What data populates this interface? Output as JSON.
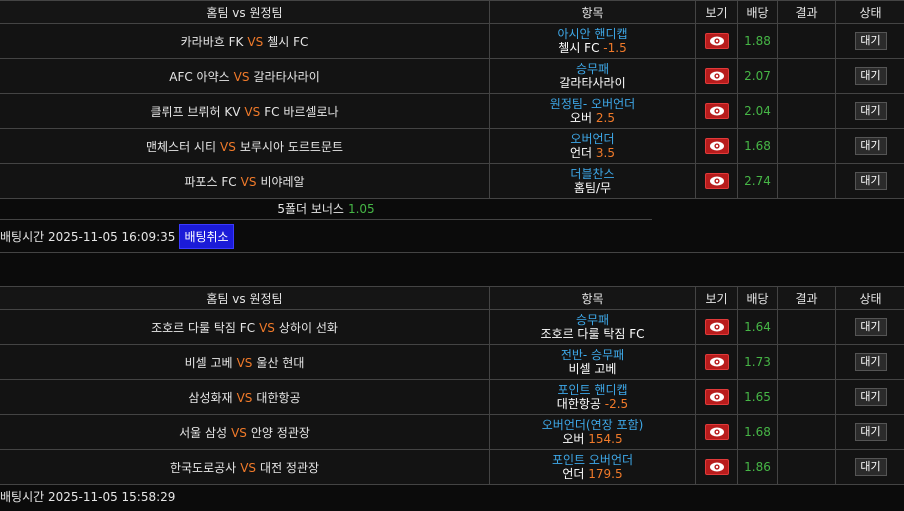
{
  "columns": {
    "match": "홈팀 vs 원정팀",
    "market": "항목",
    "view": "보기",
    "odds": "배당",
    "result": "결과",
    "status": "상태"
  },
  "vs": "VS",
  "slips": [
    {
      "rows": [
        {
          "home": "카라바흐 FK",
          "away": "첼시 FC",
          "market": "아시안 핸디캡",
          "pick": "첼시 FC",
          "pick_value": "-1.5",
          "odds": "1.88",
          "result": "",
          "status": "대기"
        },
        {
          "home": "AFC 아약스",
          "away": "갈라타사라이",
          "market": "승무패",
          "pick": "갈라타사라이",
          "pick_value": "",
          "odds": "2.07",
          "result": "",
          "status": "대기"
        },
        {
          "home": "클뤼프 브뤼허 KV",
          "away": "FC 바르셀로나",
          "market": "원정팀- 오버언더",
          "pick": "오버",
          "pick_value": "2.5",
          "odds": "2.04",
          "result": "",
          "status": "대기"
        },
        {
          "home": "맨체스터 시티",
          "away": "보루시아 도르트문트",
          "market": "오버언더",
          "pick": "언더",
          "pick_value": "3.5",
          "odds": "1.68",
          "result": "",
          "status": "대기"
        },
        {
          "home": "파포스 FC",
          "away": "비야레알",
          "market": "더블찬스",
          "pick": "홈팀/무",
          "pick_value": "",
          "odds": "2.74",
          "result": "",
          "status": "대기"
        }
      ],
      "bonus_label": "5폴더 보너스",
      "bonus_value": "1.05",
      "bet_time": "배팅시간 2025-11-05 16:09:35",
      "cancel_label": "배팅취소"
    },
    {
      "rows": [
        {
          "home": "조호르 다룰 탁짐 FC",
          "away": "상하이 선화",
          "market": "승무패",
          "pick": "조호르 다룰 탁짐 FC",
          "pick_value": "",
          "odds": "1.64",
          "result": "",
          "status": "대기"
        },
        {
          "home": "비셀 고베",
          "away": "울산 현대",
          "market": "전반- 승무패",
          "pick": "비셀 고베",
          "pick_value": "",
          "odds": "1.73",
          "result": "",
          "status": "대기"
        },
        {
          "home": "삼성화재",
          "away": "대한항공",
          "market": "포인트 핸디캡",
          "pick": "대한항공",
          "pick_value": "-2.5",
          "odds": "1.65",
          "result": "",
          "status": "대기"
        },
        {
          "home": "서울 삼성",
          "away": "안양 정관장",
          "market": "오버언더(연장 포함)",
          "pick": "오버",
          "pick_value": "154.5",
          "odds": "1.68",
          "result": "",
          "status": "대기"
        },
        {
          "home": "한국도로공사",
          "away": "대전 정관장",
          "market": "포인트 오버언더",
          "pick": "언더",
          "pick_value": "179.5",
          "odds": "1.86",
          "result": "",
          "status": "대기"
        }
      ],
      "bet_time": "배팅시간 2025-11-05 15:58:29"
    }
  ],
  "icons": {
    "view": "eye-icon"
  },
  "colors": {
    "vs": "#f07a2a",
    "market": "#3ea8e8",
    "odds": "#46b646",
    "view_button": "#b81c1c",
    "cancel_button": "#1b1bd8"
  }
}
